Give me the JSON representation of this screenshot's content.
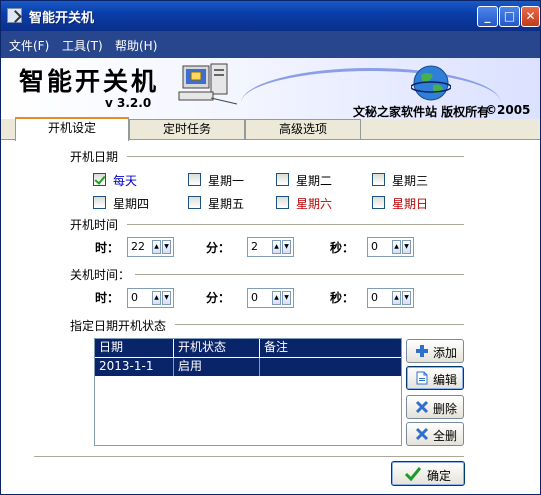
{
  "window": {
    "title": "智能开关机"
  },
  "menu": [
    "文件(F)",
    "工具(T)",
    "帮助(H)"
  ],
  "banner": {
    "product": "智能开关机",
    "version": "v 3.2.0",
    "publisher": "文秘之家软件站  版权所有",
    "copyright": "©2005"
  },
  "tabs": [
    "开机设定",
    "定时任务",
    "高级选项"
  ],
  "boot_date": {
    "label": "开机日期",
    "days": [
      {
        "label": "每天",
        "checked": true
      },
      {
        "label": "星期一",
        "checked": false
      },
      {
        "label": "星期二",
        "checked": false
      },
      {
        "label": "星期三",
        "checked": false
      },
      {
        "label": "星期四",
        "checked": false
      },
      {
        "label": "星期五",
        "checked": false
      },
      {
        "label": "星期六",
        "checked": false
      },
      {
        "label": "星期日",
        "checked": false
      }
    ]
  },
  "boot_time": {
    "label": "开机时间",
    "hour_label": "时：",
    "minute_label": "分：",
    "second_label": "秒：",
    "hour": "22",
    "minute": "2",
    "second": "0"
  },
  "shutdown_time": {
    "label": "关机时间：",
    "hour_label": "时：",
    "minute_label": "分：",
    "second_label": "秒：",
    "hour": "0",
    "minute": "0",
    "second": "0"
  },
  "schedule": {
    "label": "指定日期开机状态",
    "columns": [
      "日期",
      "开机状态",
      "备注"
    ],
    "rows": [
      [
        "2013-1-1",
        "启用",
        ""
      ]
    ]
  },
  "buttons": {
    "add": "添加",
    "edit": "编辑",
    "delete": "删除",
    "clear": "全删",
    "ok": "确定"
  },
  "colors": {
    "accent": "#0a246a",
    "weekend": "#c00000",
    "everyday": "#0000c8"
  }
}
